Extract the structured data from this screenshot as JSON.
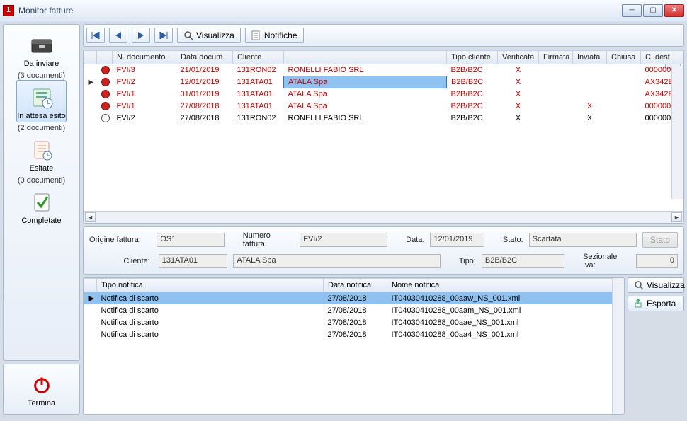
{
  "titlebar": {
    "title": "Monitor fatture"
  },
  "sidebar": {
    "items": [
      {
        "key": "da-inviare",
        "label": "Da inviare",
        "count": "(3 documenti)",
        "selected": false
      },
      {
        "key": "in-attesa-esito",
        "label": "In attesa esito",
        "count": "(2 documenti)",
        "selected": true
      },
      {
        "key": "esitate",
        "label": "Esitate",
        "count": "(0 documenti)",
        "selected": false
      },
      {
        "key": "completate",
        "label": "Completate",
        "count": "",
        "selected": false
      }
    ],
    "terminate_label": "Termina"
  },
  "toolbar": {
    "visualizza_label": "Visualizza",
    "notifiche_label": "Notifiche"
  },
  "grid": {
    "columns": [
      "",
      "",
      "N. documento",
      "Data docum.",
      "Cliente",
      "",
      "Tipo cliente",
      "Verificata",
      "Firmata",
      "Inviata",
      "Chiusa",
      "C. dest"
    ],
    "rows": [
      {
        "marker": "",
        "dot": "red",
        "ndoc": "FVI/3",
        "data": "21/01/2019",
        "cliente_code": "131RON02",
        "cliente_name": "RONELLI FABIO SRL",
        "tipo": "B2B/B2C",
        "verificata": "X",
        "firmata": "",
        "inviata": "",
        "chiusa": "",
        "cdest": "000000",
        "red": true,
        "sel": false
      },
      {
        "marker": "▶",
        "dot": "red",
        "ndoc": "FVI/2",
        "data": "12/01/2019",
        "cliente_code": "131ATA01",
        "cliente_name": "ATALA Spa",
        "tipo": "B2B/B2C",
        "verificata": "X",
        "firmata": "",
        "inviata": "",
        "chiusa": "",
        "cdest": "AX342E",
        "red": true,
        "sel": true
      },
      {
        "marker": "",
        "dot": "red",
        "ndoc": "FVI/1",
        "data": "01/01/2019",
        "cliente_code": "131ATA01",
        "cliente_name": "ATALA Spa",
        "tipo": "B2B/B2C",
        "verificata": "X",
        "firmata": "",
        "inviata": "",
        "chiusa": "",
        "cdest": "AX342E",
        "red": true,
        "sel": false
      },
      {
        "marker": "",
        "dot": "red",
        "ndoc": "FVI/1",
        "data": "27/08/2018",
        "cliente_code": "131ATA01",
        "cliente_name": "ATALA Spa",
        "tipo": "B2B/B2C",
        "verificata": "X",
        "firmata": "",
        "inviata": "X",
        "chiusa": "",
        "cdest": "000000",
        "red": true,
        "sel": false
      },
      {
        "marker": "",
        "dot": "white",
        "ndoc": "FVI/2",
        "data": "27/08/2018",
        "cliente_code": "131RON02",
        "cliente_name": "RONELLI FABIO SRL",
        "tipo": "B2B/B2C",
        "verificata": "X",
        "firmata": "",
        "inviata": "X",
        "chiusa": "",
        "cdest": "000000",
        "red": false,
        "sel": false
      }
    ]
  },
  "details": {
    "origine_label": "Origine fattura:",
    "origine_value": "OS1",
    "numero_label": "Numero fattura:",
    "numero_value": "FVI/2",
    "data_label": "Data:",
    "data_value": "12/01/2019",
    "stato_label": "Stato:",
    "stato_value": "Scartata",
    "stato_btn": "Stato",
    "cliente_label": "Cliente:",
    "cliente_code": "131ATA01",
    "cliente_name": "ATALA Spa",
    "tipo_label": "Tipo:",
    "tipo_value": "B2B/B2C",
    "sezionale_label": "Sezionale Iva:",
    "sezionale_value": "0"
  },
  "notif": {
    "columns": [
      "",
      "Tipo notifica",
      "Data notifica",
      "Nome notifica"
    ],
    "rows": [
      {
        "marker": "▶",
        "tipo": "Notifica di scarto",
        "data": "27/08/2018",
        "nome": "IT04030410288_00aaw_NS_001.xml",
        "sel": true
      },
      {
        "marker": "",
        "tipo": "Notifica di scarto",
        "data": "27/08/2018",
        "nome": "IT04030410288_00aam_NS_001.xml",
        "sel": false
      },
      {
        "marker": "",
        "tipo": "Notifica di scarto",
        "data": "27/08/2018",
        "nome": "IT04030410288_00aae_NS_001.xml",
        "sel": false
      },
      {
        "marker": "",
        "tipo": "Notifica di scarto",
        "data": "27/08/2018",
        "nome": "IT04030410288_00aa4_NS_001.xml",
        "sel": false
      }
    ],
    "visualizza_label": "Visualizza",
    "esporta_label": "Esporta"
  }
}
